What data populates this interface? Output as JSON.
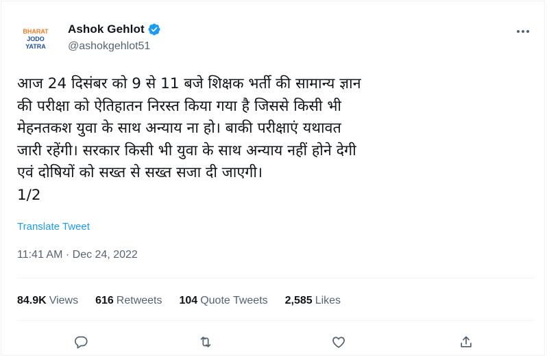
{
  "author": {
    "name": "Ashok Gehlot",
    "handle": "@ashokgehlot51",
    "avatar_text": [
      "BHARAT",
      "JODO",
      "YATRA"
    ]
  },
  "tweet": {
    "text": "आज 24 दिसंबर को 9 से 11 बजे शिक्षक भर्ती की सामान्य ज्ञान\nकी परीक्षा को ऐतिहातन निरस्त किया गया है जिससे किसी भी\nमेहनतकश युवा के साथ अन्याय ना हो। बाकी परीक्षाएं यथावत\nजारी रहेंगी। सरकार किसी भी युवा के साथ अन्याय नहीं होने देगी\nएवं दोषियों को सख्त से सख्त सजा दी जाएगी।\n1/2",
    "translate_label": "Translate Tweet",
    "timestamp": "11:41 AM · Dec 24, 2022"
  },
  "stats": {
    "views_count": "84.9K",
    "views_label": "Views",
    "retweets_count": "616",
    "retweets_label": "Retweets",
    "quotes_count": "104",
    "quotes_label": "Quote Tweets",
    "likes_count": "2,585",
    "likes_label": "Likes"
  },
  "actions": [
    "reply-icon",
    "retweet-icon",
    "like-icon",
    "share-icon"
  ],
  "colors": {
    "accent": "#1d9bf0",
    "text_primary": "#0f1419",
    "text_secondary": "#536471",
    "border": "#eff3f4",
    "avatar_orange": "#f47b20",
    "avatar_blue": "#1f4ea1"
  }
}
